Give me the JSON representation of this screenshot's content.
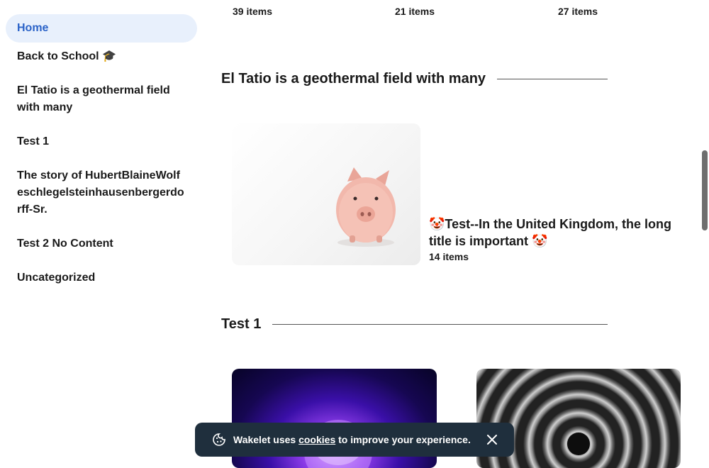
{
  "sidebar": {
    "items": [
      {
        "label": "Home",
        "active": true
      },
      {
        "label": "Back to School 🎓"
      },
      {
        "label": "El Tatio is a geothermal field with many"
      },
      {
        "label": "Test 1"
      },
      {
        "label": "The story of HubertBlaineWolfeschlegelsteinhausenbergerdorff-Sr."
      },
      {
        "label": "Test 2 No Content"
      },
      {
        "label": "Uncategorized"
      }
    ]
  },
  "top_counts": [
    "39 items",
    "21 items",
    "27 items"
  ],
  "sections": [
    {
      "title": "El Tatio is a geothermal field with many",
      "card": {
        "title": "🤡Test--In the United Kingdom, the long title is important 🤡",
        "count": "14 items",
        "image": "piggy-bank-photo"
      }
    },
    {
      "title": "Test 1",
      "cards": [
        {
          "image": "purple-planet-photo"
        },
        {
          "image": "spiral-tunnel-photo"
        }
      ]
    }
  ],
  "cookie_banner": {
    "prefix": "Wakelet uses ",
    "link": "cookies",
    "suffix": " to improve your experience.",
    "icon": "cookie-icon",
    "close_icon": "close-icon"
  },
  "colors": {
    "accent": "#2b63c8",
    "active_bg": "#e8f0fc",
    "banner_bg": "#1f2f3d"
  }
}
